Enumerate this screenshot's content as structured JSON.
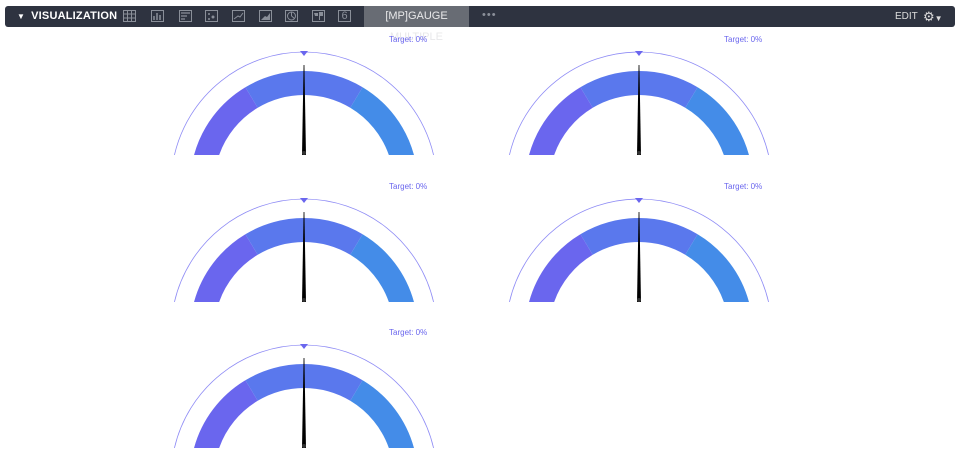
{
  "toolbar": {
    "title": "VISUALIZATION",
    "icons": [
      "table-icon",
      "bar-chart-icon",
      "row-chart-icon",
      "scatter-icon",
      "line-chart-icon",
      "area-chart-icon",
      "pie-chart-icon",
      "map-icon",
      "number-icon"
    ],
    "number_icon_label": "6",
    "selected_viz": "[MP]GAUGE MULTIPLE",
    "more": "•••",
    "edit": "EDIT"
  },
  "gauges": [
    {
      "target": "Target: 0%",
      "value": 0,
      "target_value": 0
    },
    {
      "target": "Target: 0%",
      "value": 0,
      "target_value": 0
    },
    {
      "target": "Target: 0%",
      "value": 0,
      "target_value": 0
    },
    {
      "target": "Target: 0%",
      "value": 0,
      "target_value": 0
    },
    {
      "target": "Target: 0%",
      "value": 0,
      "target_value": 0
    }
  ],
  "colors": {
    "segment_low": "#6a66ee",
    "segment_mid": "#5a78ed",
    "segment_high": "#448ce8",
    "target_arc": "#8f8cf5",
    "needle": "#000000",
    "toolbar": "#2e3340"
  }
}
